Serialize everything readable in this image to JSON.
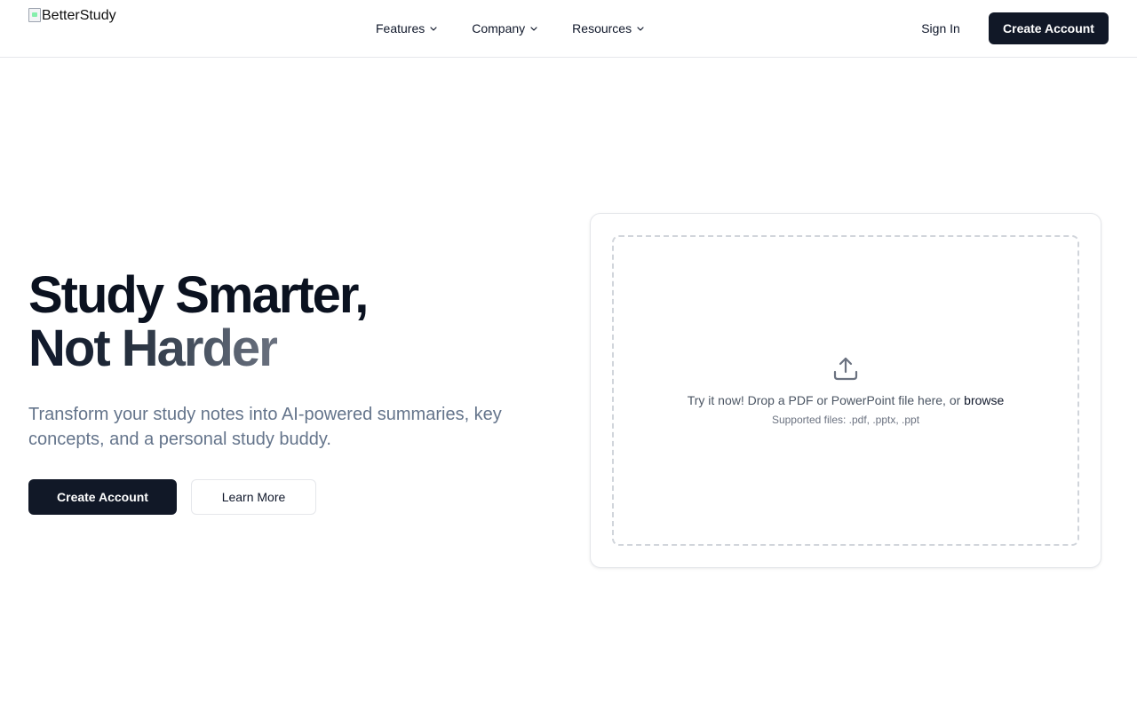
{
  "header": {
    "logo_alt": "BetterStudy",
    "nav": [
      {
        "label": "Features"
      },
      {
        "label": "Company"
      },
      {
        "label": "Resources"
      }
    ],
    "sign_in_label": "Sign In",
    "create_account_label": "Create Account"
  },
  "hero": {
    "title_line1": "Study Smarter,",
    "title_line2": "Not Harder",
    "subtitle": "Transform your study notes into AI-powered summaries, key concepts, and a personal study buddy.",
    "primary_label": "Create Account",
    "secondary_label": "Learn More"
  },
  "upload": {
    "prompt": "Try it now! Drop a PDF or PowerPoint file here, or ",
    "browse_label": "browse",
    "supported": "Supported files: .pdf, .pptx, .ppt",
    "icon": "upload-icon"
  },
  "colors": {
    "primary": "#111827",
    "muted_text": "#64748b",
    "border": "#e5e7eb"
  }
}
